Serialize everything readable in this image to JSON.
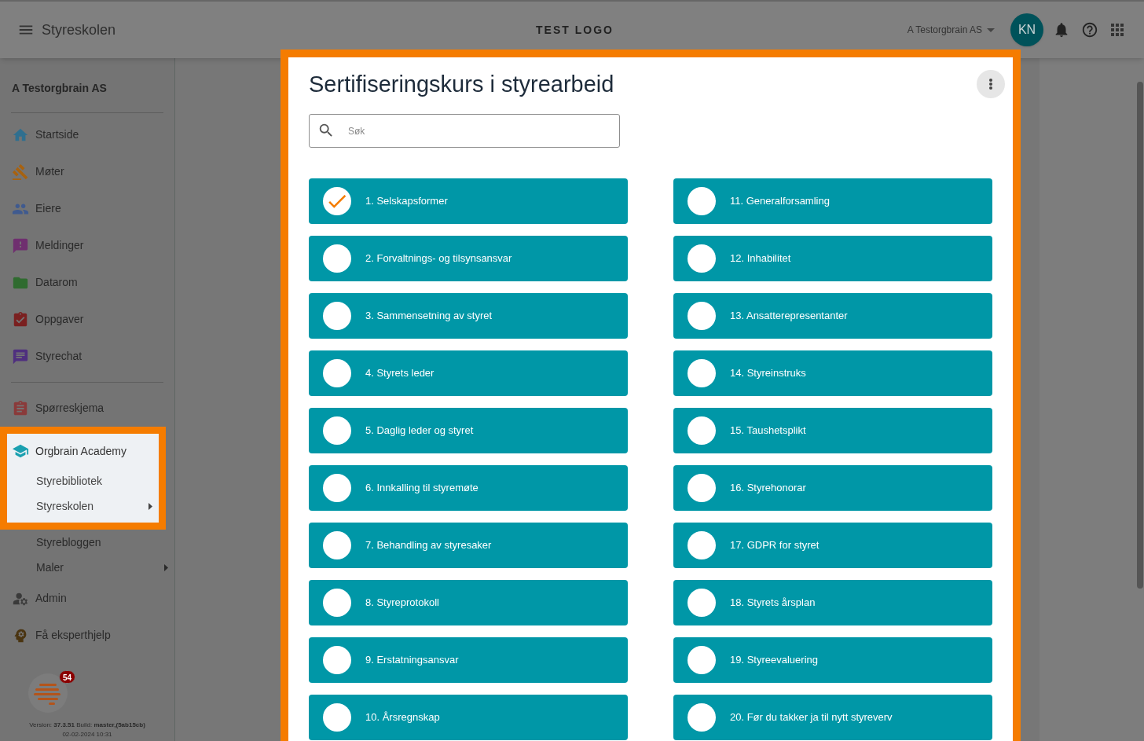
{
  "topbar": {
    "title": "Styreskolen",
    "logo": "TEST LOGO",
    "organization": "A Testorgbrain AS",
    "avatar": "KN"
  },
  "sidebar": {
    "organization": "A Testorgbrain AS",
    "items": [
      {
        "label": "Startside"
      },
      {
        "label": "Møter"
      },
      {
        "label": "Eiere"
      },
      {
        "label": "Meldinger"
      },
      {
        "label": "Datarom"
      },
      {
        "label": "Oppgaver"
      },
      {
        "label": "Styrechat"
      }
    ],
    "items_2": [
      {
        "label": "Spørreskjema"
      }
    ],
    "academy": {
      "label": "Orgbrain Academy",
      "children": [
        {
          "label": "Styrebibliotek",
          "submenu": false
        },
        {
          "label": "Styreskolen",
          "submenu": true
        }
      ]
    },
    "more_children": [
      {
        "label": "Styrebloggen",
        "submenu": false
      },
      {
        "label": "Maler",
        "submenu": true
      }
    ],
    "items_3": [
      {
        "label": "Admin"
      },
      {
        "label": "Få eksperthjelp"
      }
    ],
    "badge": "54",
    "version": "Version: **37.3.51** Build: **master,(5ab15cb)**",
    "build_date": "02-02-2024 10:31"
  },
  "course": {
    "title": "Sertifiseringskurs i styrearbeid",
    "search": {
      "placeholder": "Søk"
    },
    "lessons": [
      {
        "label": "1. Selskapsformer",
        "completed": true
      },
      {
        "label": "2. Forvaltnings- og tilsynsansvar",
        "completed": false
      },
      {
        "label": "3. Sammensetning av styret",
        "completed": false
      },
      {
        "label": "4. Styrets leder",
        "completed": false
      },
      {
        "label": "5. Daglig leder og styret",
        "completed": false
      },
      {
        "label": "6. Innkalling til styremøte",
        "completed": false
      },
      {
        "label": "7. Behandling av styresaker",
        "completed": false
      },
      {
        "label": "8. Styreprotokoll",
        "completed": false
      },
      {
        "label": "9. Erstatningsansvar",
        "completed": false
      },
      {
        "label": "10. Årsregnskap",
        "completed": false
      },
      {
        "label": "11. Generalforsamling",
        "completed": false
      },
      {
        "label": "12. Inhabilitet",
        "completed": false
      },
      {
        "label": "13. Ansatterepresentanter",
        "completed": false
      },
      {
        "label": "14. Styreinstruks",
        "completed": false
      },
      {
        "label": "15. Taushetsplikt",
        "completed": false
      },
      {
        "label": "16. Styrehonorar",
        "completed": false
      },
      {
        "label": "17. GDPR for styret",
        "completed": false
      },
      {
        "label": "18. Styrets årsplan",
        "completed": false
      },
      {
        "label": "19. Styreevaluering",
        "completed": false
      },
      {
        "label": "20. Før du takker ja til nytt styreverv",
        "completed": false
      }
    ]
  }
}
